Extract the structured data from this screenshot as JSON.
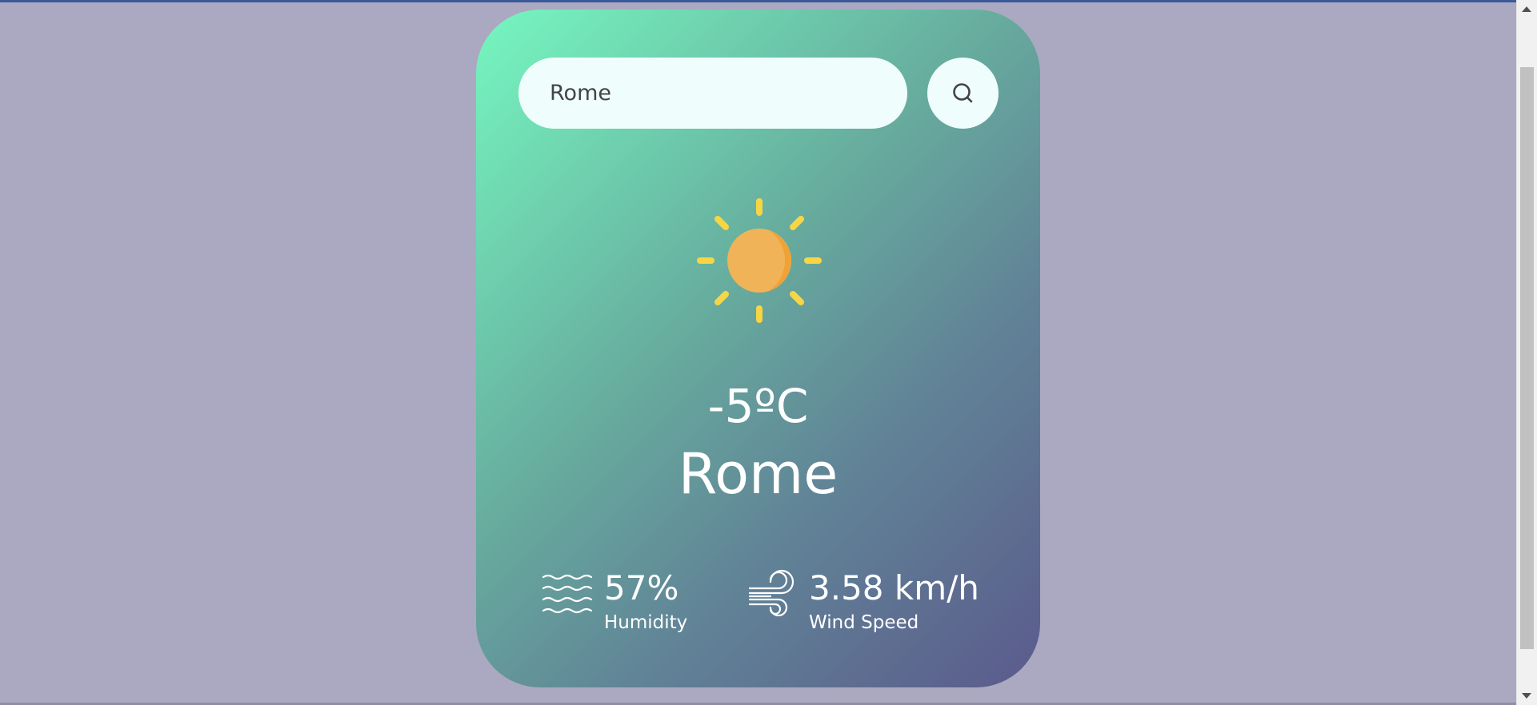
{
  "search": {
    "value": "Rome",
    "button_icon": "search-icon"
  },
  "weather": {
    "icon": "sun-icon",
    "temperature": "-5ºC",
    "city": "Rome"
  },
  "details": {
    "humidity": {
      "icon": "humidity-waves-icon",
      "value": "57%",
      "label": "Humidity"
    },
    "wind": {
      "icon": "wind-icon",
      "value": "3.58 km/h",
      "label": "Wind Speed"
    }
  },
  "colors": {
    "page_background": "#aaa9c1",
    "card_gradient_start": "#76f7c0",
    "card_gradient_end": "#5b5a8c",
    "sun_core": "#f0b357",
    "sun_rays": "#f8d543"
  }
}
